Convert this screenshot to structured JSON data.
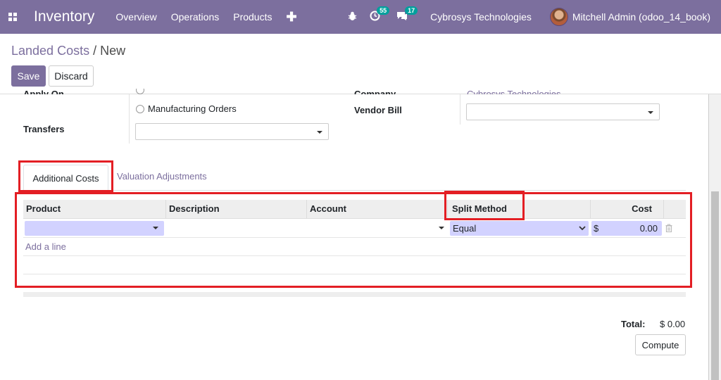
{
  "navbar": {
    "app_title": "Inventory",
    "menu": [
      "Overview",
      "Operations",
      "Products"
    ],
    "activity_count": "55",
    "messages_count": "17",
    "company": "Cybrosys Technologies",
    "user": "Mitchell Admin (odoo_14_book)",
    "background_color": "#7c6f9e"
  },
  "breadcrumb": {
    "parent": "Landed Costs",
    "separator": "/",
    "current": "New"
  },
  "buttons": {
    "save": "Save",
    "discard": "Discard",
    "compute": "Compute"
  },
  "form": {
    "apply_on_label": "Apply On",
    "manufacturing_orders_label": "Manufacturing Orders",
    "transfers_label": "Transfers",
    "transfers_value": "",
    "company_label": "Company",
    "company_value": "Cybrosys Technologies",
    "vendor_bill_label": "Vendor Bill",
    "vendor_bill_value": ""
  },
  "tabs": [
    {
      "label": "Additional Costs",
      "active": true
    },
    {
      "label": "Valuation Adjustments",
      "active": false
    }
  ],
  "table": {
    "columns": [
      "Product",
      "Description",
      "Account",
      "Split Method",
      "Cost"
    ],
    "rows": [
      {
        "product": "",
        "description": "",
        "account": "",
        "split_method": "Equal",
        "currency": "$",
        "cost": "0.00"
      }
    ],
    "add_line": "Add a line"
  },
  "total": {
    "label": "Total:",
    "value": "$ 0.00"
  },
  "colors": {
    "highlight": "#e31e24",
    "accent": "#7c6f9e",
    "edit_field": "#d2d2ff"
  }
}
